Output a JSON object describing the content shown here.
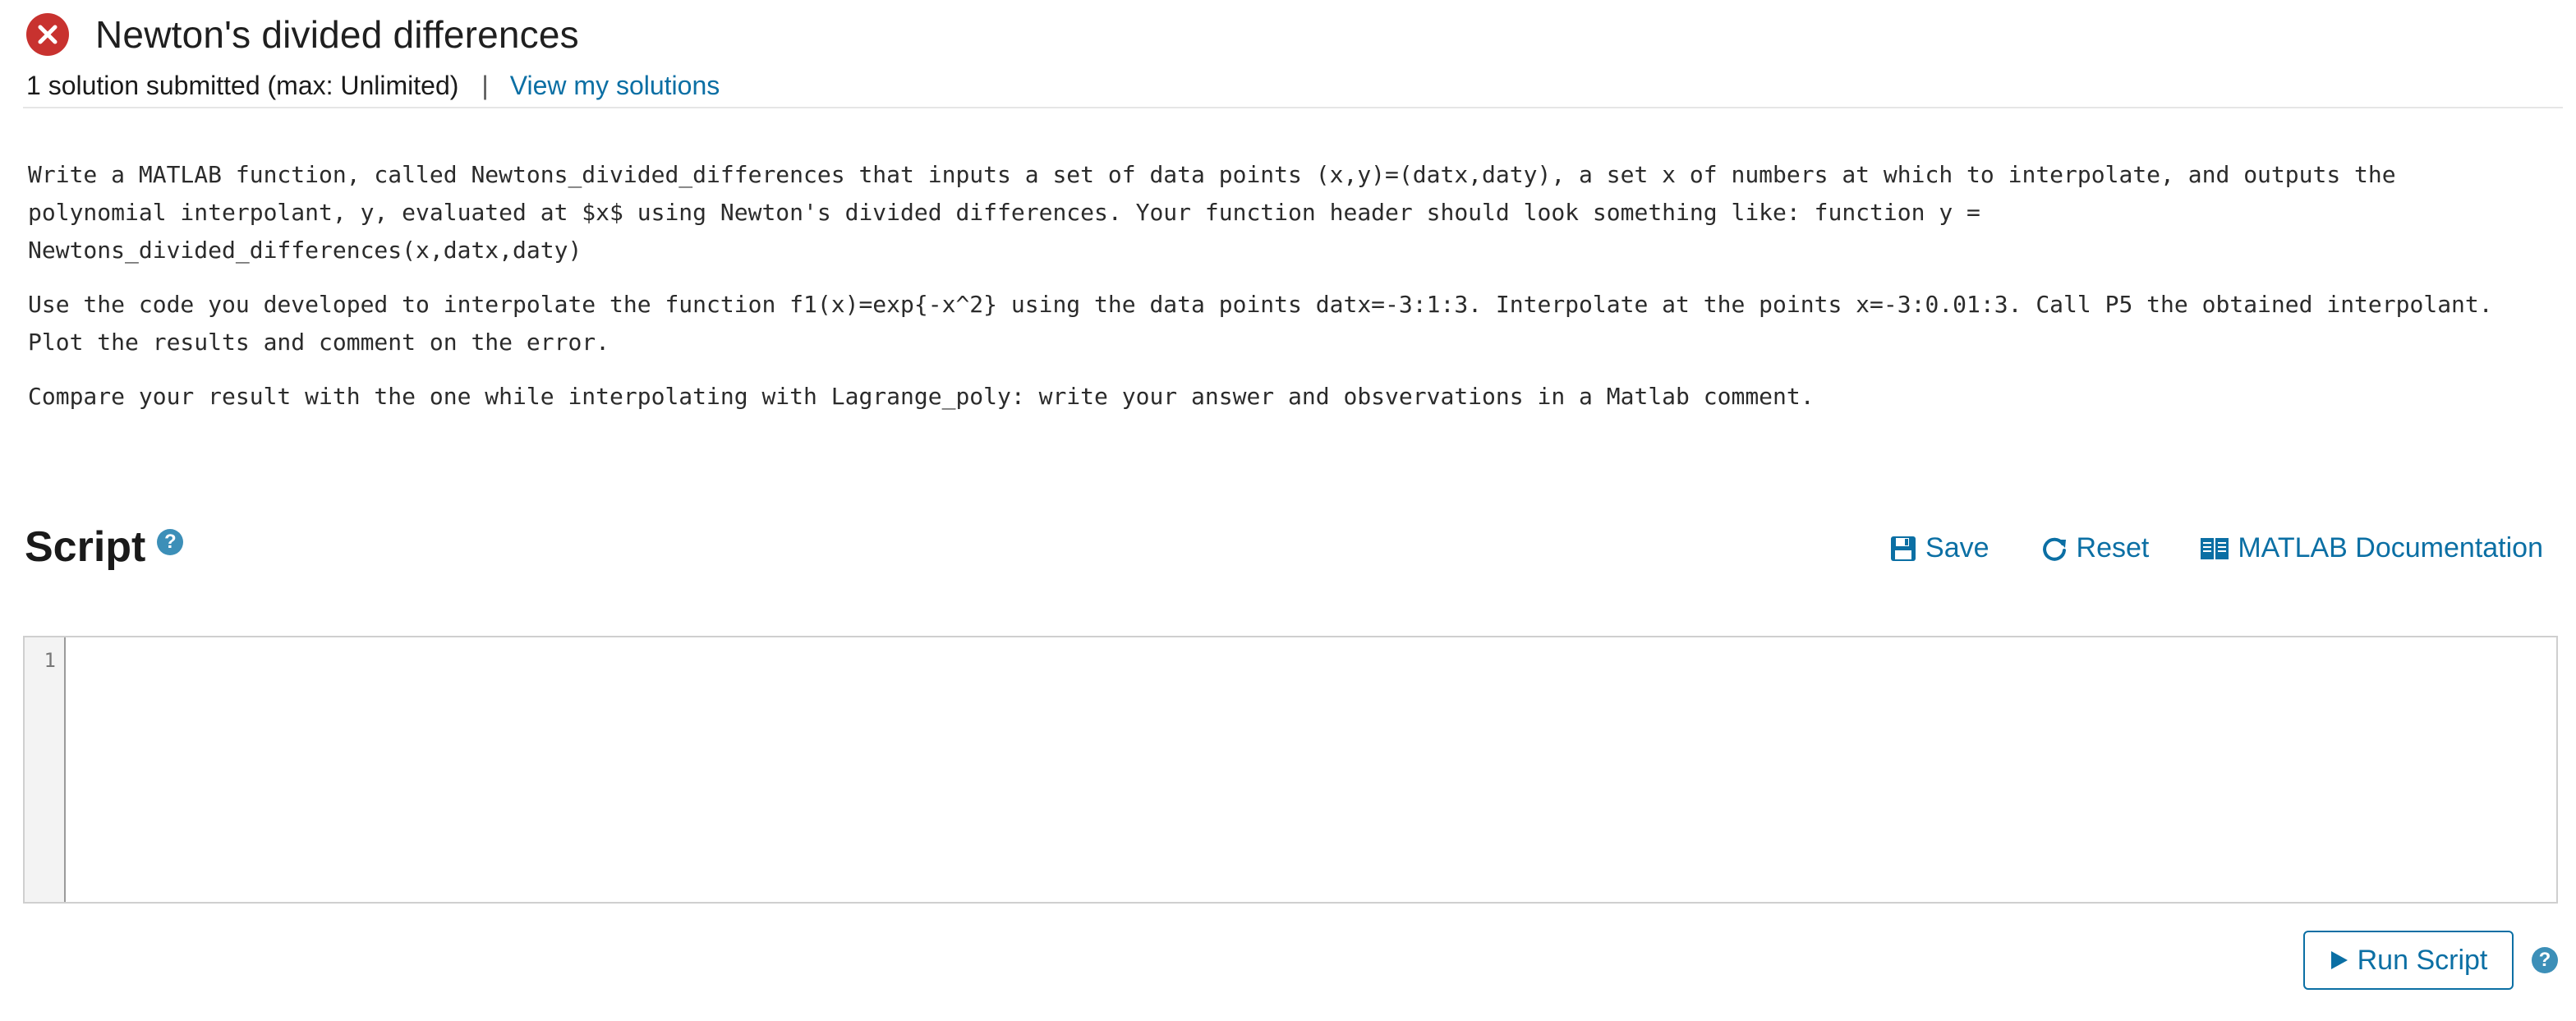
{
  "header": {
    "title": "Newton's divided differences",
    "status_icon": "error-x-icon",
    "status_color": "#c8322f",
    "submission_info": "1 solution submitted (max: Unlimited)",
    "separator": "|",
    "view_solutions_link": "View my solutions"
  },
  "description": {
    "paragraphs": [
      "Write a MATLAB function, called Newtons_divided_differences that inputs a set of data points (x,y)=(datx,daty), a set x of numbers at which to interpolate, and outputs the polynomial interpolant, y, evaluated at $x$ using Newton's divided differences. Your function header should look something like: function y = Newtons_divided_differences(x,datx,daty)",
      "Use the code you developed to interpolate the function f1(x)=exp{-x^2} using the data points datx=-3:1:3. Interpolate at the points x=-3:0.01:3. Call P5 the obtained interpolant. Plot the results and comment on the error.",
      "Compare your result with the one while interpolating with Lagrange_poly: write your answer and obsvervations in a Matlab comment."
    ]
  },
  "script": {
    "title": "Script",
    "help_icon": "question-circle-icon",
    "toolbar": {
      "save_label": "Save",
      "reset_label": "Reset",
      "docs_label": "MATLAB Documentation"
    },
    "editor": {
      "line_numbers": [
        "1"
      ],
      "content": ""
    },
    "run_label": "Run Script"
  },
  "colors": {
    "accent": "#0b6fa4",
    "help": "#3c8fb8"
  }
}
